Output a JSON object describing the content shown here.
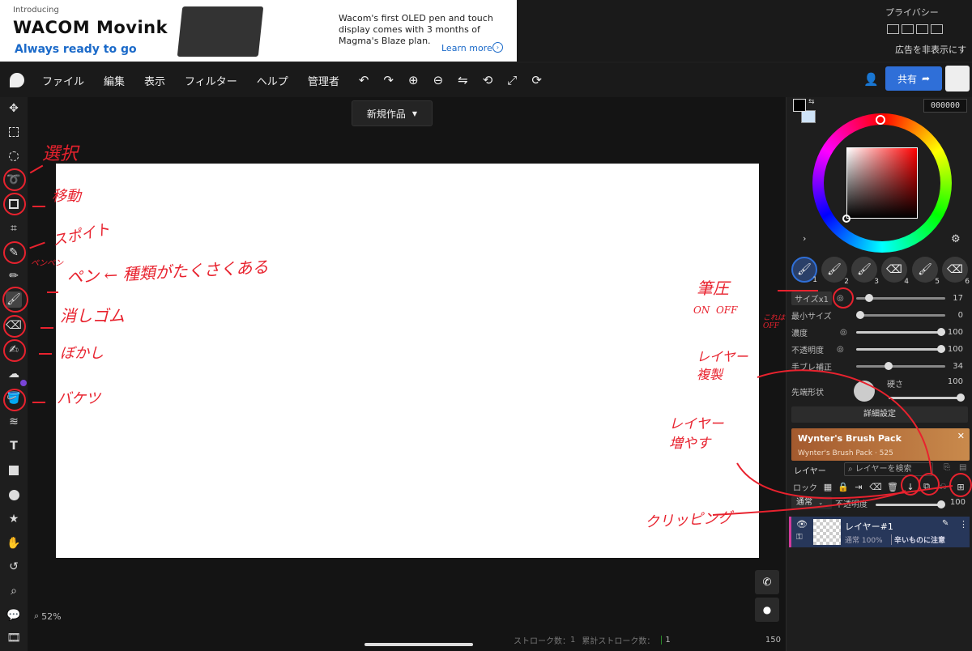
{
  "ad": {
    "introducing": "Introducing",
    "brand": "WACOM Movink",
    "tagline": "Always ready to go",
    "body": "Wacom's first OLED pen and touch display comes with 3 months of Magma's Blaze plan.",
    "learn_more": "Learn more",
    "privacy": "プライバシー",
    "hide_ads": "広告を非表示にす"
  },
  "menu": [
    "ファイル",
    "編集",
    "表示",
    "フィルター",
    "ヘルプ",
    "管理者"
  ],
  "share_label": "共有",
  "doc_title": "新規作品",
  "zoom": "52%",
  "status": {
    "stroke_label": "ストローク数：",
    "stroke_value": "1",
    "total_label": "累計ストローク数：",
    "total_value": "1",
    "frame_value": "150"
  },
  "color": {
    "hex": "000000",
    "primary": "#000000",
    "secondary": "#cfe3f7"
  },
  "brushes": [
    "1",
    "2",
    "3",
    "4",
    "5",
    "6"
  ],
  "brush_settings": [
    {
      "label": "サイズx1",
      "value": "17",
      "level": 0.1
    },
    {
      "label": "最小サイズ",
      "value": "0",
      "level": 0.0
    },
    {
      "label": "濃度",
      "value": "100",
      "level": 1.0
    },
    {
      "label": "不透明度",
      "value": "100",
      "level": 1.0
    },
    {
      "label": "手ブレ補正",
      "value": "34",
      "level": 0.34
    }
  ],
  "tip_shape_label": "先端形状",
  "hardness_label": "硬さ",
  "hardness_value": "100",
  "detail_settings": "詳細設定",
  "promo": {
    "title": "Wynter's Brush Pack",
    "subtitle": "Wynter's Brush Pack · 525"
  },
  "layer_panel": {
    "title": "レイヤー",
    "search_placeholder": "レイヤーを検索",
    "lock_label": "ロック",
    "blend_mode": "通常",
    "opacity_label": "不透明度",
    "opacity_value": "100"
  },
  "layers": [
    {
      "name": "レイヤー#1",
      "meta": "通常 100%",
      "note": "辛いものに注意"
    }
  ],
  "annotations": {
    "select": "選択",
    "move": "移動",
    "eyedropper": "スポイト",
    "pen_small": "ペンペン",
    "pen": "ペン ← 種類がたくさくある",
    "eraser": "消しゴム",
    "blur": "ぼかし",
    "bucket": "バケツ",
    "pressure": "筆圧",
    "on_off": "ON  OFF",
    "this_is_off": "これはOFF",
    "layer_dup": "レイヤー複製",
    "layer_add": "レイヤー増やす",
    "clipping": "クリッピング"
  }
}
